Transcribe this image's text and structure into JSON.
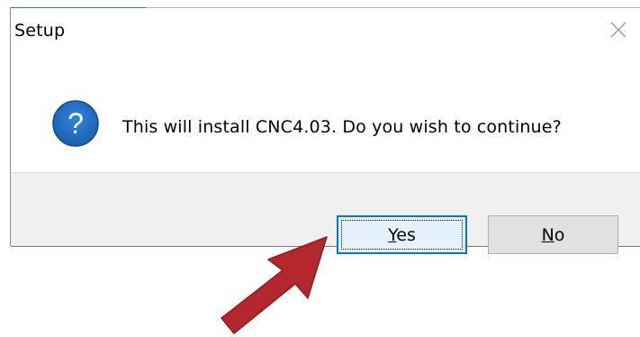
{
  "dialog": {
    "title": "Setup",
    "message": "This will install CNC4.03. Do you wish to continue?",
    "icon": "question-icon",
    "close_icon": "close-icon"
  },
  "buttons": {
    "yes": {
      "mnemonic": "Y",
      "rest": "es"
    },
    "no": {
      "mnemonic": "N",
      "rest": "o"
    }
  },
  "annotation": {
    "arrow_icon": "pointer-arrow-icon",
    "arrow_color": "#b3272d"
  },
  "colors": {
    "accent_focus": "#0078d7",
    "icon_blue": "#1f6fc6",
    "button_bar": "#f0f0f0"
  }
}
